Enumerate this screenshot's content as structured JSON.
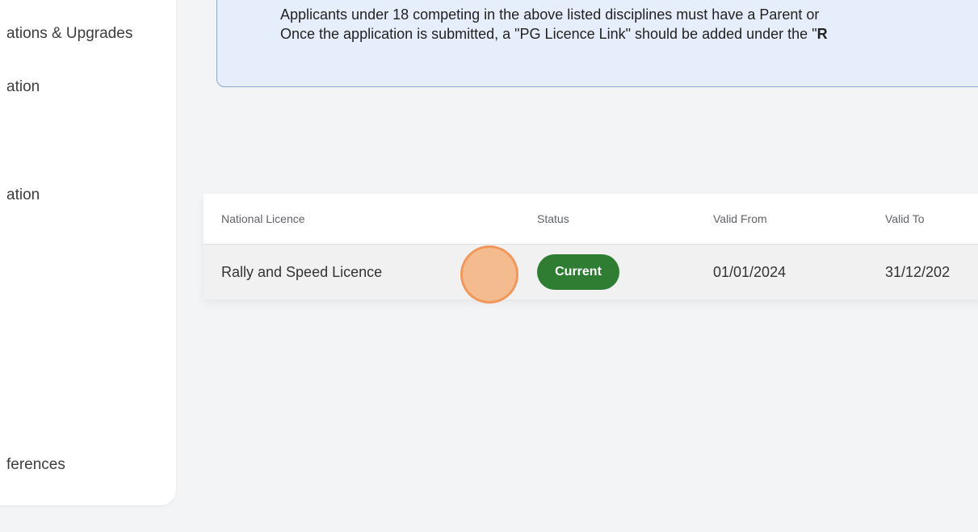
{
  "sidebar": {
    "items": [
      {
        "label": "ations & Upgrades"
      },
      {
        "label": "ation"
      },
      {
        "label": "ation"
      },
      {
        "label": "ferences"
      }
    ]
  },
  "notice": {
    "line1": "Applicants under 18 competing in the above listed disciplines must have a Parent or",
    "line2_prefix": "Once the application is submitted, a \"PG Licence Link\" should be added under the \"",
    "line2_bold": "R"
  },
  "table": {
    "headers": {
      "licence": "National Licence",
      "status": "Status",
      "valid_from": "Valid From",
      "valid_to": "Valid To"
    },
    "rows": [
      {
        "licence": "Rally and Speed Licence",
        "status": "Current",
        "valid_from": "01/01/2024",
        "valid_to": "31/12/202"
      }
    ]
  },
  "colors": {
    "status_current": "#2e7d32",
    "notice_bg": "#e7eefb",
    "click_indicator": "#f4a86e"
  }
}
